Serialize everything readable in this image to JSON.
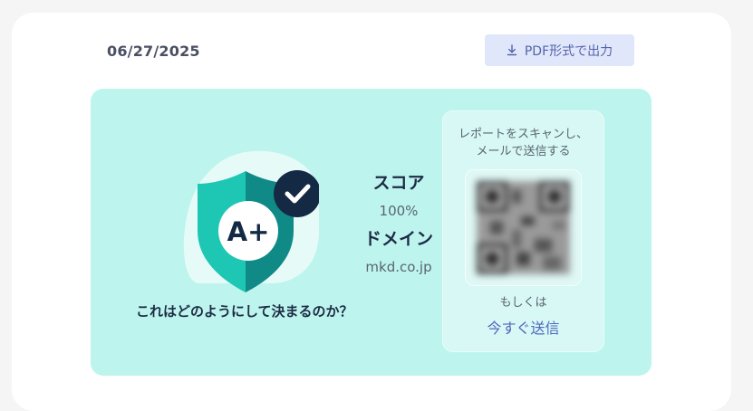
{
  "header": {
    "date": "06/27/2025",
    "export_pdf_label": "PDF形式で出力",
    "export_icon": "download-icon"
  },
  "result": {
    "grade": "A+",
    "badge_icon": "shield-check-icon",
    "how_link": "これはどのようにして決まるのか？",
    "score_label": "スコア",
    "score_value": "100%",
    "domain_label": "ドメイン",
    "domain_value": "mkd.co.jp"
  },
  "share": {
    "scan_text_line1": "レポートをスキャンし、",
    "scan_text_line2": "メールで送信する",
    "qr_icon": "qr-code",
    "or_text": "もしくは",
    "send_now_label": "今すぐ送信"
  },
  "colors": {
    "panel_bg": "#bdf5ee",
    "shield_light": "#1ec7b3",
    "shield_dark": "#108a86",
    "check_badge": "#142a44",
    "accent_link": "#5167bf"
  }
}
